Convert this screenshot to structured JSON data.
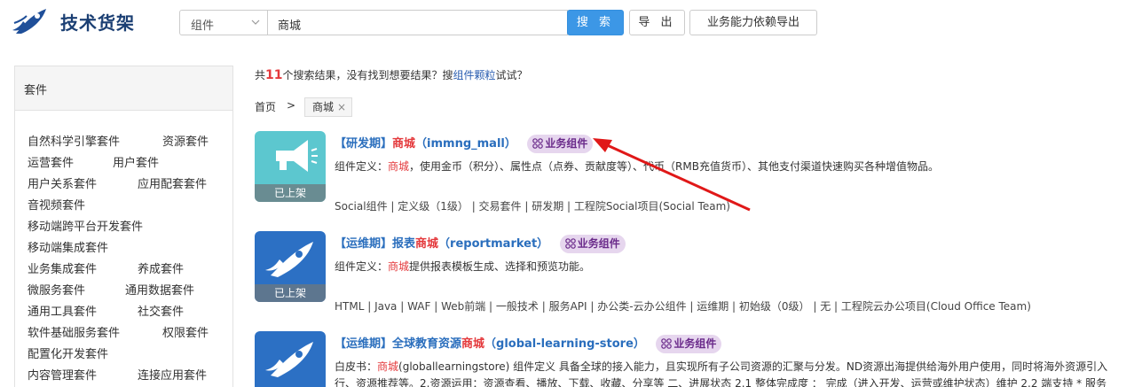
{
  "header": {
    "app_title": "技术货架",
    "search_type": "组件",
    "search_value": "商城",
    "search_button": "搜 索",
    "export_button": "导 出",
    "dep_export_button": "业务能力依赖导出"
  },
  "sidebar": {
    "title": "套件",
    "items": [
      "自然科学引擎套件",
      "资源套件",
      "运营套件",
      "用户套件",
      "用户关系套件",
      "应用配套套件",
      "音视频套件",
      "移动端跨平台开发套件",
      "移动端集成套件",
      "业务集成套件",
      "养成套件",
      "微服务套件",
      "通用数据套件",
      "通用工具套件",
      "社交套件",
      "软件基础服务套件",
      "权限套件",
      "配置化开发套件",
      "内容管理套件",
      "连接应用套件"
    ]
  },
  "summary": {
    "prefix": "共",
    "count": "11",
    "middle": "个搜索结果，没有找到想要结果？搜",
    "link": "组件颗粒",
    "suffix": "试试？"
  },
  "breadcrumb": {
    "home": "首页",
    "sep": ">",
    "tag": "商城",
    "tag_close": "×"
  },
  "results": [
    {
      "title_prefix": "【研发期】",
      "title_hl": "商城",
      "title_suffix": "（immng_mall）",
      "badge": "业务组件",
      "status": "已上架",
      "def_prefix": "组件定义：",
      "def_hl": "商城",
      "def_rest": "，使用金币（积分）、属性点（点券、贡献度等）、代币（RMB充值货币）、其他支付渠道快速购买各种增值物品。",
      "tags": "Social组件 | 定义级（1级） | 交易套件 | 研发期 | 工程院Social项目(Social Team)",
      "icon": "megaphone-icon",
      "color": "#5cc7cf"
    },
    {
      "title_prefix": "【运维期】报表",
      "title_hl": "商城",
      "title_suffix": "（reportmarket）",
      "badge": "业务组件",
      "status": "已上架",
      "def_prefix": "组件定义：",
      "def_hl": "商城",
      "def_rest": "提供报表模板生成、选择和预览功能。",
      "tags": "HTML | Java | WAF | Web前端 | 一般技术 | 服务API | 办公类-云办公组件 | 运维期 | 初始级（0级） | 无 | 工程院云办公项目(Cloud Office Team)",
      "icon": "rocket-icon",
      "color": "#2c70c4"
    },
    {
      "title_prefix": "【运维期】全球教育资源",
      "title_hl": "商城",
      "title_suffix": "（global-learning-store）",
      "badge": "业务组件",
      "def_prefix": "白皮书：",
      "def_hl": "商城",
      "def_rest": "(globallearningstore) 组件定义 具备全球的接入能力，且实现所有子公司资源的汇聚与分发。ND资源出海提供给海外用户使用，同时将海外资源引入",
      "def_line2": "行、资源推荐等。2.资源运用：资源查看、播放、下载、收藏、分享等 二、进展状态 2.1 整体完成度 ： 完成（进入开发、运营或维护状态）维护 2.2 端支持 * 服务",
      "icon": "rocket-icon",
      "color": "#2c70c4"
    }
  ],
  "colors": {
    "accent": "#3c97e6",
    "highlight": "#e4393c",
    "badge_bg": "#e6d6ee",
    "arrow": "#e01818"
  }
}
